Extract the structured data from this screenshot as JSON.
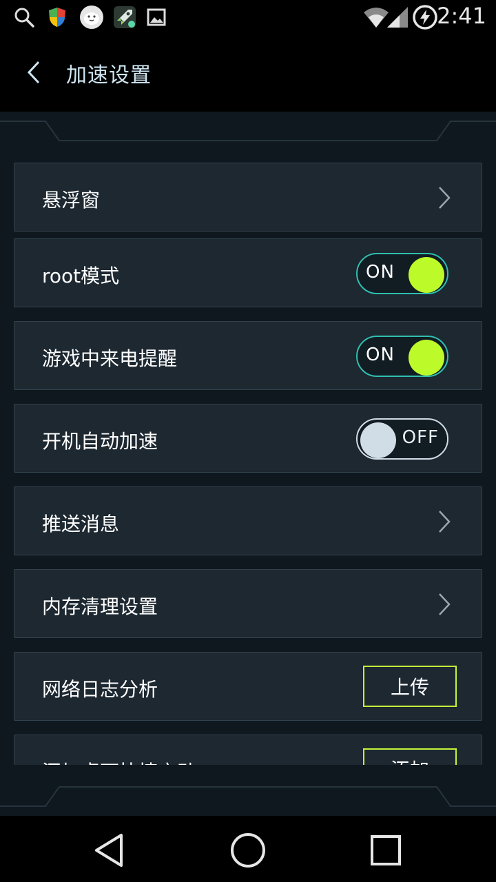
{
  "status_bar": {
    "time": "2:41",
    "icons": [
      "search-icon",
      "shield-icon",
      "mascot-icon",
      "rocket-icon",
      "image-icon",
      "wifi-icon",
      "signal-icon",
      "battery-charging-icon"
    ]
  },
  "app_bar": {
    "title": "加速设置",
    "back_icon": "chevron-left-icon"
  },
  "settings": [
    {
      "label": "悬浮窗",
      "control": "chevron"
    },
    {
      "label": "root模式",
      "control": "toggle",
      "state": "ON",
      "on": true
    },
    {
      "label": "游戏中来电提醒",
      "control": "toggle",
      "state": "ON",
      "on": true
    },
    {
      "label": "开机自动加速",
      "control": "toggle",
      "state": "OFF",
      "on": false
    },
    {
      "label": "推送消息",
      "control": "chevron"
    },
    {
      "label": "内存清理设置",
      "control": "chevron"
    },
    {
      "label": "网络日志分析",
      "control": "button",
      "button_label": "上传"
    },
    {
      "label": "添加桌面快捷启动",
      "control": "button",
      "button_label": "添加"
    }
  ],
  "nav_bar": {
    "icons": [
      "back-triangle-icon",
      "home-circle-icon",
      "recents-square-icon"
    ]
  },
  "colors": {
    "accent": "#bdfa2a",
    "toggle_border": "#2fbfb0",
    "row_bg": "#1d2831",
    "page_bg": "#0f181e"
  }
}
